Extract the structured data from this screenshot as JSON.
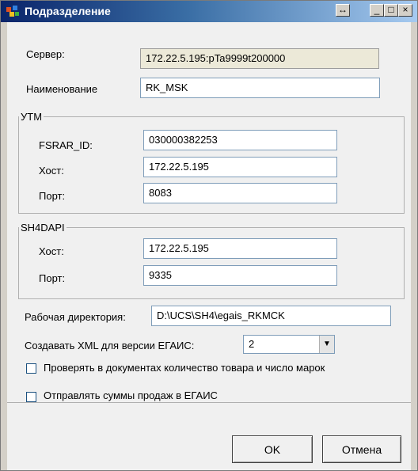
{
  "window": {
    "title": "Подразделение",
    "controls": {
      "resize_glyph": "↔",
      "minimize_glyph": "_",
      "maximize_glyph": "□",
      "close_glyph": "×"
    }
  },
  "server": {
    "label": "Сервер:",
    "value": "172.22.5.195:pTa9999t200000"
  },
  "name": {
    "label": "Наименование",
    "value": "RK_MSK"
  },
  "utm": {
    "legend": "УТМ",
    "fsrar_label": "FSRAR_ID:",
    "fsrar_value": "030000382253",
    "host_label": "Хост:",
    "host_value": "172.22.5.195",
    "port_label": "Порт:",
    "port_value": "8083"
  },
  "sh4dapi": {
    "legend": "SH4DAPI",
    "host_label": "Хост:",
    "host_value": "172.22.5.195",
    "port_label": "Порт:",
    "port_value": "9335"
  },
  "workdir": {
    "label": "Рабочая директория:",
    "value": "D:\\UCS\\SH4\\egais_RKMCK"
  },
  "xml_version": {
    "label": "Создавать XML для версии ЕГАИС:",
    "value": "2"
  },
  "check_quantity": {
    "label": "Проверять в документах количество товара и число марок",
    "checked": false
  },
  "send_sales": {
    "label": "Отправлять суммы продаж  в ЕГАИС",
    "checked": false
  },
  "buttons": {
    "ok": "OK",
    "cancel": "Отмена"
  },
  "colors": {
    "titlebar_start": "#0a246a",
    "titlebar_end": "#a6caf0",
    "dialog_bg": "#f0f0f0",
    "input_border": "#7f9db9"
  }
}
